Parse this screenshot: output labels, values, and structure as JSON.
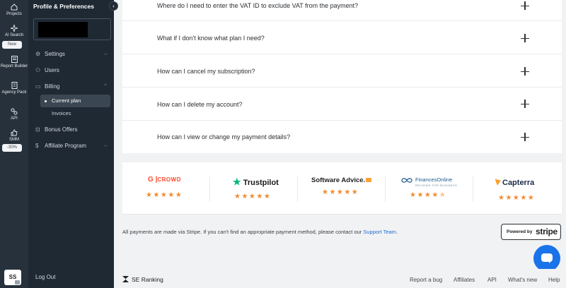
{
  "rail": {
    "items": [
      {
        "label": "Projects",
        "icon": "home-icon"
      },
      {
        "label": "AI Search",
        "icon": "sparkle-icon",
        "badge": "New"
      },
      {
        "label": "Report Builder",
        "icon": "report-icon"
      },
      {
        "label": "Agency Pack",
        "icon": "building-icon"
      },
      {
        "label": "API",
        "icon": "api-icon"
      },
      {
        "label": "SMM",
        "icon": "thumbs-up-icon",
        "badge": "-30%"
      }
    ],
    "avatar": "SS"
  },
  "panel": {
    "title": "Profile & Preferences",
    "nav": [
      {
        "label": "Settings",
        "icon": "gear-icon",
        "expanded": false
      },
      {
        "label": "Users",
        "icon": "users-icon"
      },
      {
        "label": "Billing",
        "icon": "card-icon",
        "expanded": true
      },
      {
        "label": "Bonus Offers",
        "icon": "gift-icon"
      },
      {
        "label": "Affiliate Program",
        "icon": "dollar-icon",
        "expanded": false
      }
    ],
    "billing_sub": [
      {
        "label": "Current plan",
        "active": true
      },
      {
        "label": "Invoices",
        "active": false
      }
    ],
    "logout": "Log Out"
  },
  "faq": [
    "Where do I need to enter the VAT ID to exclude VAT from the payment?",
    "What if I don't know what plan I need?",
    "How can I cancel my subscription?",
    "How can I delete my account?",
    "How can I view or change my payment details?"
  ],
  "reviews": {
    "g2": {
      "mark": "G",
      "word": "CROWD",
      "rating": 5
    },
    "trustpilot": {
      "name": "Trustpilot",
      "rating": 5
    },
    "software_advice": {
      "name": "Software Advice.",
      "rating": 5
    },
    "financesonline": {
      "name": "FinancesOnline",
      "tagline": "REVIEWS FOR BUSINESS",
      "rating": 4.5
    },
    "capterra": {
      "name": "Capterra",
      "rating": 5
    }
  },
  "payment": {
    "text": "All payments are made via Stripe. If you can't find an appropriate payment method, please contact our ",
    "link": "Support Team",
    "end": ".",
    "powered_by": "Powered by",
    "stripe": "stripe"
  },
  "footer": {
    "brand": "SE Ranking",
    "links": [
      "Report a bug",
      "Affiliates",
      "API",
      "What's new",
      "Help"
    ]
  },
  "colors": {
    "accent": "#1a73e8",
    "sidebar": "#1f2934",
    "star": "#f38a2e"
  }
}
